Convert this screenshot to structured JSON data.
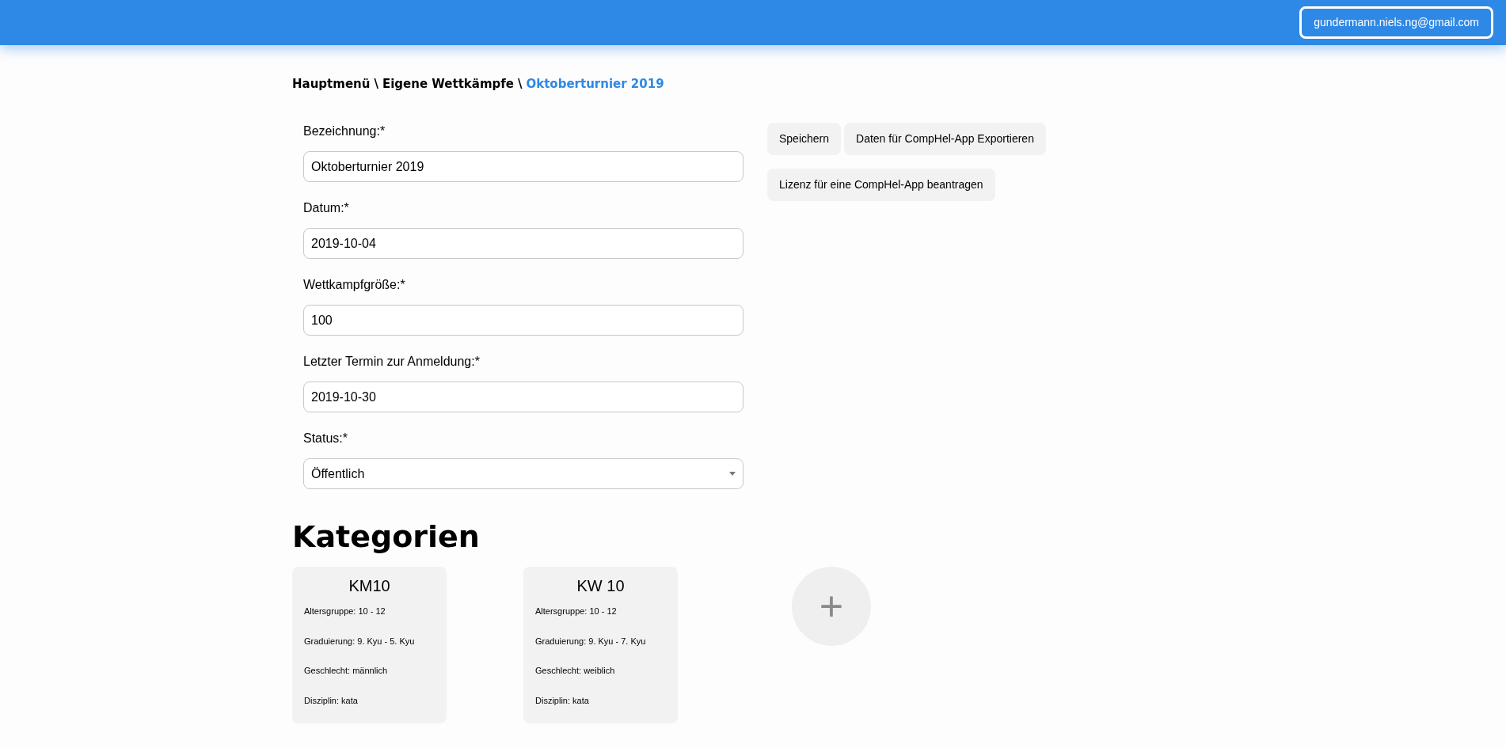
{
  "header": {
    "user_email": "gundermann.niels.ng@gmail.com"
  },
  "breadcrumb_separator": "\\",
  "breadcrumb": [
    {
      "label": "Hauptmenü",
      "current": false
    },
    {
      "label": "Eigene Wettkämpfe",
      "current": false
    },
    {
      "label": "Oktoberturnier 2019",
      "current": true
    }
  ],
  "form": {
    "fields": [
      {
        "kind": "text",
        "label": "Bezeichnung:*",
        "value": "Oktoberturnier 2019"
      },
      {
        "kind": "text",
        "label": "Datum:*",
        "value": "2019-10-04"
      },
      {
        "kind": "text",
        "label": "Wettkampfgröße:*",
        "value": "100"
      },
      {
        "kind": "text",
        "label": "Letzter Termin zur Anmeldung:*",
        "value": "2019-10-30"
      },
      {
        "kind": "select",
        "label": "Status:*",
        "value": "Öffentlich"
      }
    ]
  },
  "actions": [
    [
      "Speichern",
      "Daten für CompHel-App Exportieren"
    ],
    [
      "Lizenz für eine CompHel-App beantragen"
    ]
  ],
  "categories": {
    "title": "Kategorien",
    "cards": [
      {
        "name": "KM10",
        "details": [
          "Altersgruppe: 10 - 12",
          "Graduierung: 9. Kyu - 5. Kyu",
          "Geschlecht: männlich",
          "Disziplin: kata"
        ]
      },
      {
        "name": "KW 10",
        "details": [
          "Altersgruppe: 10 - 12",
          "Graduierung: 9. Kyu - 7. Kyu",
          "Geschlecht: weiblich",
          "Disziplin: kata"
        ]
      }
    ],
    "add_button": "+"
  }
}
